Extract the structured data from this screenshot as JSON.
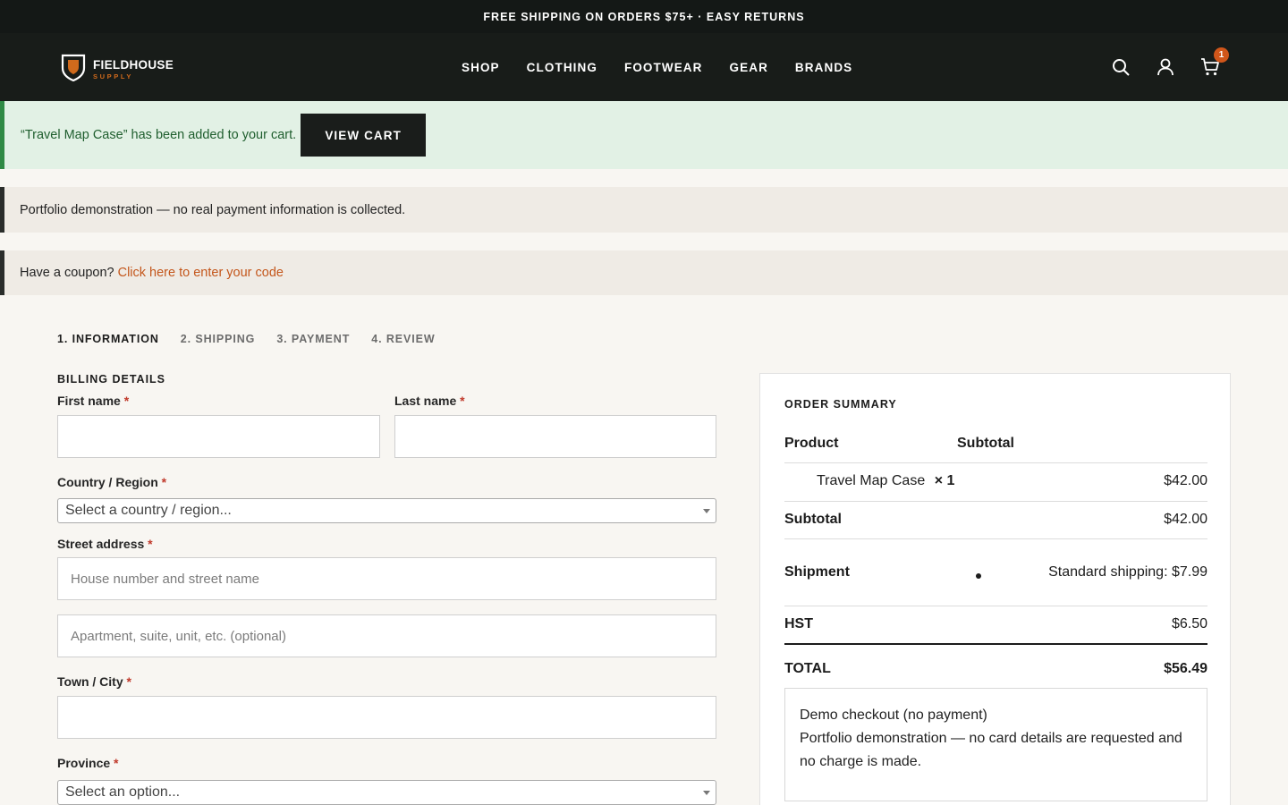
{
  "announcement": "FREE SHIPPING ON ORDERS $75+ · EASY RETURNS",
  "brand": {
    "name": "FIELDHOUSE",
    "tagline": "SUPPLY",
    "accent": "#d06a1c"
  },
  "nav": [
    "SHOP",
    "CLOTHING",
    "FOOTWEAR",
    "GEAR",
    "BRANDS"
  ],
  "header_icons": {
    "search": "search-icon",
    "account": "user-icon",
    "cart": "cart-icon",
    "cart_count": "1"
  },
  "notices": {
    "added": "“Travel Map Case” has been added to your cart.",
    "view_cart": "VIEW CART",
    "demo": "Portfolio demonstration — no real payment information is collected.",
    "coupon_prompt": "Have a coupon?",
    "coupon_link": "Click here to enter your code"
  },
  "steps": [
    "1. INFORMATION",
    "2. SHIPPING",
    "3. PAYMENT",
    "4. REVIEW"
  ],
  "billing": {
    "title": "BILLING DETAILS",
    "first_name": "First name",
    "last_name": "Last name",
    "country": "Country / Region",
    "country_value": "Select a country / region...",
    "street": "Street address",
    "street_placeholder": "House number and street name",
    "apt_placeholder": "Apartment, suite, unit, etc. (optional)",
    "city": "Town / City",
    "province": "Province",
    "province_value": "Select an option...",
    "required_mark": "*"
  },
  "summary": {
    "title": "ORDER SUMMARY",
    "col_product": "Product",
    "col_subtotal": "Subtotal",
    "item_name": "Travel Map Case",
    "item_qty": "× 1",
    "item_price": "$42.00",
    "subtotal_label": "Subtotal",
    "subtotal_value": "$42.00",
    "shipment_label": "Shipment",
    "shipment_value": "Standard shipping: $7.99",
    "hst_label": "HST",
    "hst_value": "$6.50",
    "total_label": "TOTAL",
    "total_value": "$56.49",
    "payment_title": "Demo checkout (no payment)",
    "payment_desc": "Portfolio demonstration — no card details are requested and no charge is made."
  }
}
